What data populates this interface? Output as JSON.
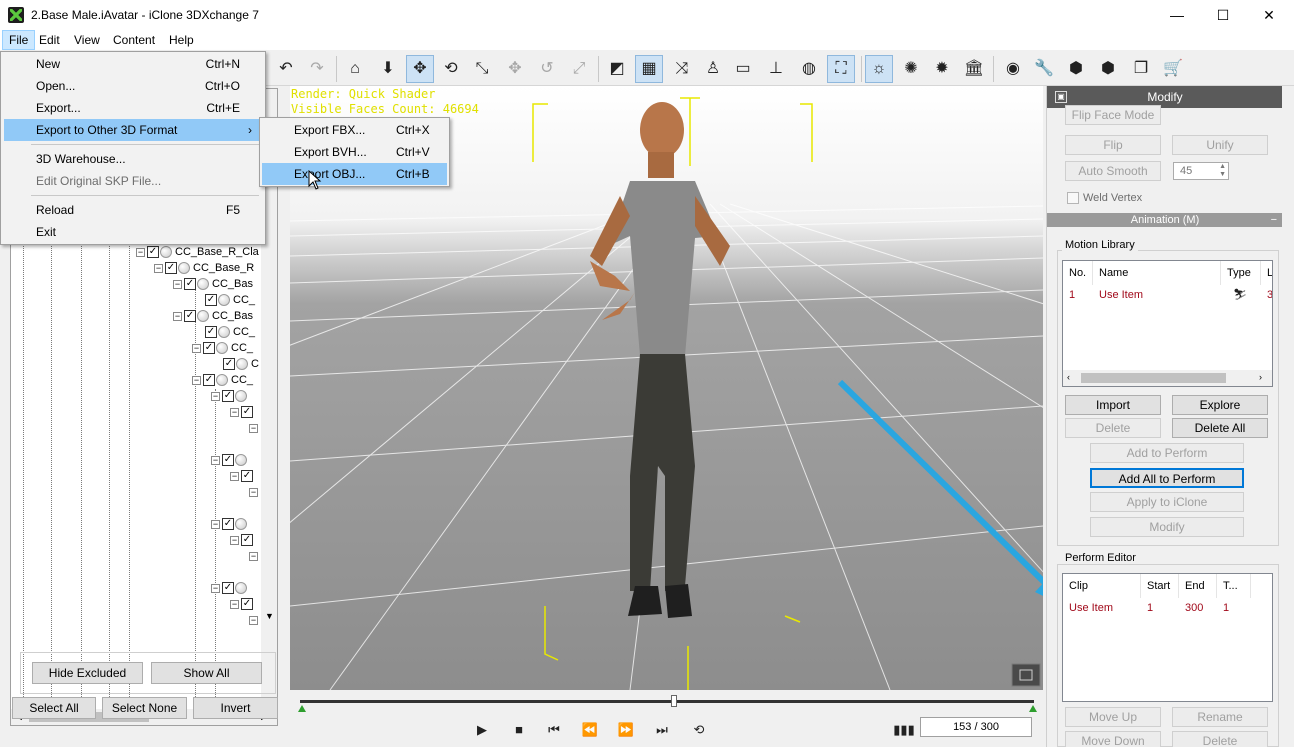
{
  "window": {
    "title": "2.Base Male.iAvatar - iClone 3DXchange 7",
    "minimize": "—",
    "maximize": "☐",
    "close": "✕"
  },
  "menubar": [
    "File",
    "Edit",
    "View",
    "Content",
    "Help"
  ],
  "file_menu": {
    "items": [
      {
        "label": "New",
        "shortcut": "Ctrl+N"
      },
      {
        "label": "Open...",
        "shortcut": "Ctrl+O"
      },
      {
        "label": "Export...",
        "shortcut": "Ctrl+E"
      },
      {
        "label": "Export to Other 3D Format",
        "arrow": "›"
      },
      {
        "label": "3D Warehouse..."
      },
      {
        "label": "Edit Original SKP File..."
      },
      {
        "label": "Reload",
        "shortcut": "F5"
      },
      {
        "label": "Exit"
      }
    ]
  },
  "export_submenu": {
    "items": [
      {
        "label": "Export FBX...",
        "shortcut": "Ctrl+X"
      },
      {
        "label": "Export BVH...",
        "shortcut": "Ctrl+V"
      },
      {
        "label": "Export OBJ...",
        "shortcut": "Ctrl+B"
      }
    ]
  },
  "toolbar": {
    "icons": [
      "undo-icon",
      "redo-icon",
      "home-icon",
      "move-down-icon",
      "move-icon",
      "rotate-icon",
      "pick-icon",
      "transform-icon",
      "reset-icon",
      "scale-icon",
      "wireframe-icon",
      "grid-icon",
      "axis-icon",
      "light-probe-icon",
      "box-icon",
      "ground-icon",
      "globe-icon",
      "frame-icon",
      "sun-icon",
      "spot-icon",
      "point-icon",
      "museum-icon",
      "sphere-icon",
      "wrench-icon",
      "cube-gear-icon",
      "cube-export-icon",
      "cube-copy-icon",
      "cart-icon"
    ]
  },
  "tree": {
    "nodes": [
      {
        "label": "CC_Base_R_Cla"
      },
      {
        "label": "CC_Base_R"
      },
      {
        "label": "CC_Bas"
      },
      {
        "label": "CC_"
      },
      {
        "label": "CC_Bas"
      },
      {
        "label": "CC_"
      },
      {
        "label": "CC_"
      },
      {
        "label": "C"
      },
      {
        "label": "CC_"
      },
      {
        "label": "C"
      }
    ]
  },
  "left_buttons": {
    "hide_excluded": "Hide Excluded",
    "show_all": "Show All",
    "select_all": "Select All",
    "select_none": "Select None",
    "invert": "Invert"
  },
  "viewport": {
    "render_label": "Render: Quick Shader",
    "faces_label": "Visible Faces Count: 46694"
  },
  "timeline": {
    "frame": "153 / 300",
    "progress": 0.51
  },
  "modify_panel": {
    "title": "Modify",
    "flip_face_mode": "Flip Face Mode",
    "flip": "Flip",
    "unify": "Unify",
    "auto_smooth": "Auto Smooth",
    "smooth_angle": "45",
    "weld_vertex": "Weld Vertex",
    "animation_header": "Animation (M)",
    "motion_library": {
      "title": "Motion Library",
      "columns": [
        "No.",
        "Name",
        "Type",
        "L"
      ],
      "rows": [
        {
          "no": "1",
          "name": "Use Item",
          "len": "3"
        }
      ]
    },
    "buttons": {
      "import": "Import",
      "explore": "Explore",
      "delete": "Delete",
      "delete_all": "Delete All",
      "add_to_perform": "Add to Perform",
      "add_all_to_perform": "Add All to Perform",
      "apply_to_iclone": "Apply to iClone",
      "modify": "Modify"
    },
    "perform_editor": {
      "title": "Perform Editor",
      "columns": [
        "Clip",
        "Start",
        "End",
        "T..."
      ],
      "rows": [
        {
          "clip": "Use Item",
          "start": "1",
          "end": "300",
          "t": "1"
        }
      ]
    },
    "bottom_buttons": {
      "move_up": "Move Up",
      "rename": "Rename",
      "move_down": "Move Down",
      "delete": "Delete"
    }
  }
}
